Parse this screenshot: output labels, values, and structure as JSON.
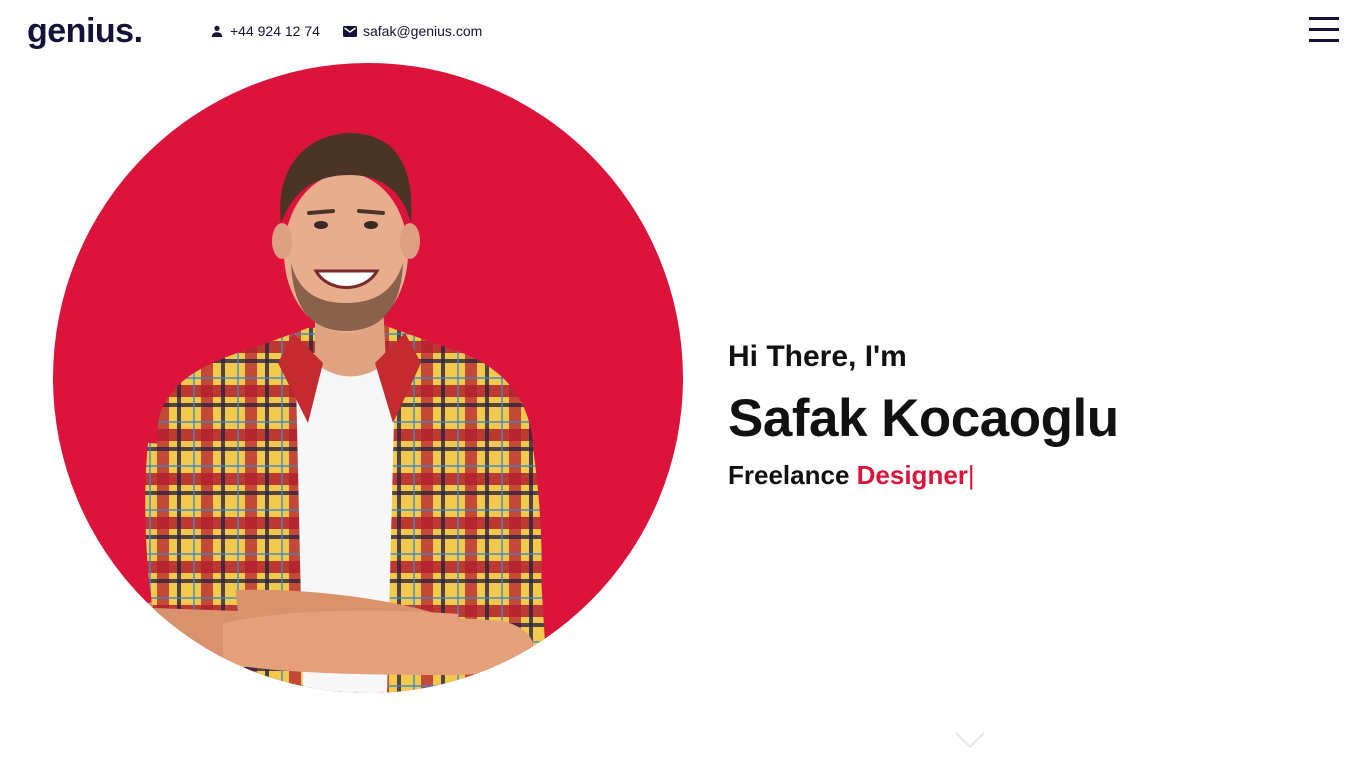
{
  "header": {
    "logo": "genius.",
    "phone": "+44 924 12 74",
    "email": "safak@genius.com",
    "icons": {
      "phone": "user-icon",
      "email": "envelope-icon",
      "menu": "hamburger-menu-icon"
    }
  },
  "hero": {
    "greeting": "Hi There, I'm",
    "name": "Safak Kocaoglu",
    "role_prefix": "Freelance ",
    "role_highlight": "Designer",
    "cursor": "|",
    "image": "smiling man in plaid shirt with arms crossed",
    "scroll_icon": "chevron-down-icon"
  },
  "colors": {
    "accent": "#dc143c",
    "brand_dark": "#14123a",
    "text": "#111111",
    "background": "#ffffff"
  }
}
